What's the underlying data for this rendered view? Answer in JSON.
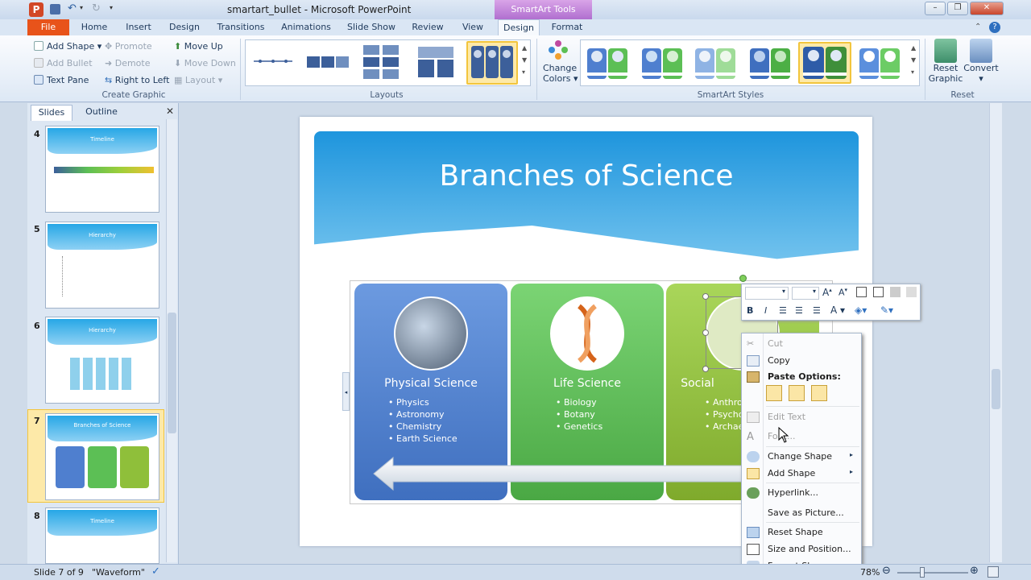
{
  "window": {
    "title": "smartart_bullet - Microsoft PowerPoint",
    "contextual_tab": "SmartArt Tools"
  },
  "tabs": [
    "File",
    "Home",
    "Insert",
    "Design",
    "Transitions",
    "Animations",
    "Slide Show",
    "Review",
    "View",
    "Design",
    "Format"
  ],
  "ribbon": {
    "create_graphic": {
      "label": "Create Graphic",
      "add_shape": "Add Shape",
      "add_bullet": "Add Bullet",
      "text_pane": "Text Pane",
      "promote": "Promote",
      "demote": "Demote",
      "right_to_left": "Right to Left",
      "move_up": "Move Up",
      "move_down": "Move Down",
      "layout": "Layout"
    },
    "layouts": {
      "label": "Layouts"
    },
    "styles": {
      "label": "SmartArt Styles",
      "change_colors_1": "Change",
      "change_colors_2": "Colors"
    },
    "reset": {
      "label": "Reset",
      "reset_graphic_1": "Reset",
      "reset_graphic_2": "Graphic",
      "convert": "Convert"
    }
  },
  "left_pane": {
    "tabs": [
      "Slides",
      "Outline"
    ],
    "slides": [
      {
        "num": "4",
        "title": "Timeline"
      },
      {
        "num": "5",
        "title": "Hierarchy"
      },
      {
        "num": "6",
        "title": "Hierarchy"
      },
      {
        "num": "7",
        "title": "Branches of Science"
      },
      {
        "num": "8",
        "title": "Timeline"
      }
    ]
  },
  "slide": {
    "title": "Branches of Science",
    "panels": [
      {
        "heading": "Physical Science",
        "bullets": [
          "Physics",
          "Astronomy",
          "Chemistry",
          "Earth Science"
        ]
      },
      {
        "heading": "Life Science",
        "bullets": [
          "Biology",
          "Botany",
          "Genetics"
        ]
      },
      {
        "heading": "Social",
        "bullets": [
          "Anthro",
          "Psycho",
          "Archae"
        ]
      }
    ]
  },
  "context_menu": {
    "cut": "Cut",
    "copy": "Copy",
    "paste_options": "Paste Options:",
    "edit_text": "Edit Text",
    "font": "Font...",
    "change_shape": "Change Shape",
    "add_shape": "Add Shape",
    "hyperlink": "Hyperlink...",
    "save_as_picture": "Save as Picture...",
    "reset_shape": "Reset Shape",
    "size_position": "Size and Position...",
    "format_shape": "Format Shape..."
  },
  "status": {
    "slide_info": "Slide 7 of 9",
    "theme": "\"Waveform\"",
    "zoom": "78%"
  },
  "colors": {
    "accent_file": "#e8531a",
    "smartart_tab": "#b06fcf",
    "panel_blue": "#4f7fcf",
    "panel_green": "#5cbf55",
    "panel_lime": "#8fbf3a"
  }
}
